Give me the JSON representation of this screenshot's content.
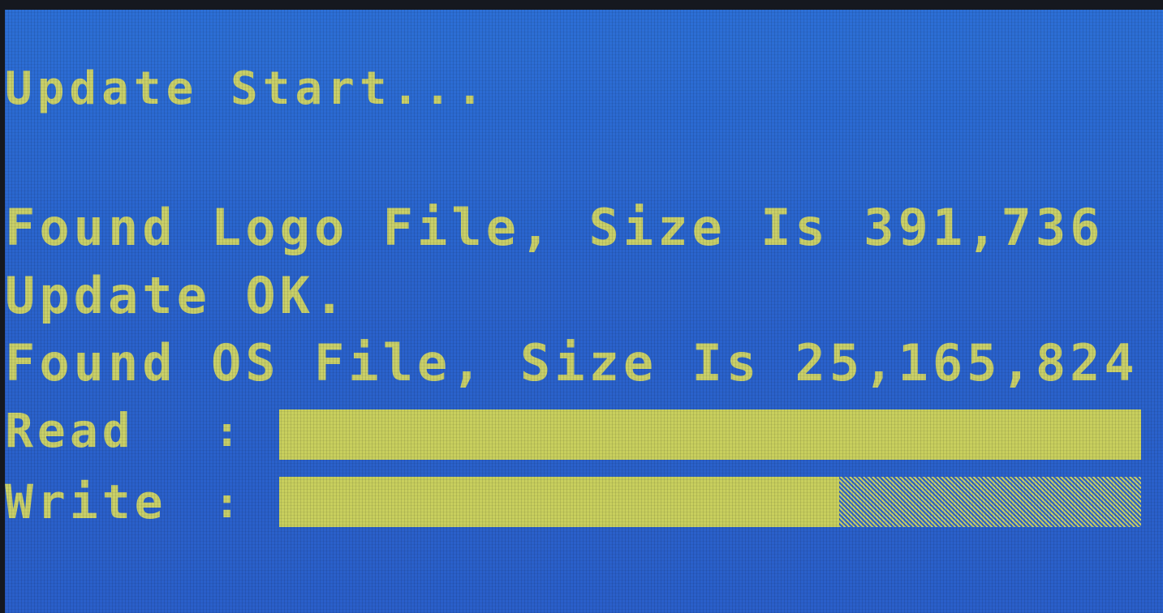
{
  "log": {
    "update_start": "Update Start...",
    "logo_found": "Found Logo File, Size Is 391,736",
    "update_ok": "Update OK.",
    "os_found": "Found OS File, Size Is 25,165,824"
  },
  "progress": {
    "read_label": "Read",
    "write_label": "Write",
    "separator": ":",
    "read_fraction": 1.0,
    "write_fraction": 0.65
  },
  "colors": {
    "background": "#2a63cc",
    "text": "#c9d06a",
    "bar_fill": "#c8cf5e"
  }
}
